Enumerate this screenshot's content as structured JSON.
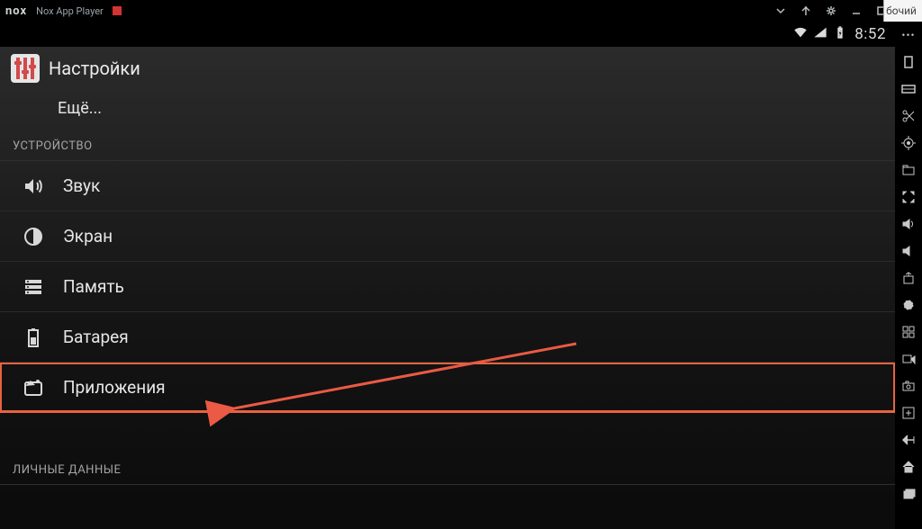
{
  "window": {
    "app_name": "Nox App Player",
    "cut_label": "бочий"
  },
  "statusbar": {
    "time": "8:52"
  },
  "settings": {
    "title": "Настройки",
    "more": "Ещё...",
    "section_device": "УСТРОЙСТВО",
    "section_personal": "ЛИЧНЫЕ ДАННЫЕ",
    "rows": {
      "sound": "Звук",
      "display": "Экран",
      "storage": "Память",
      "battery": "Батарея",
      "apps": "Приложения"
    }
  }
}
